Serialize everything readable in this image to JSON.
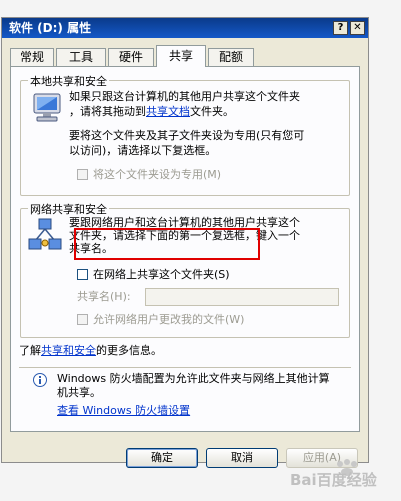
{
  "window": {
    "title": "软件 (D:) 属性",
    "help_glyph": "?",
    "close_glyph": "✕"
  },
  "tabs": [
    {
      "label": "常规"
    },
    {
      "label": "工具"
    },
    {
      "label": "硬件"
    },
    {
      "label": "共享"
    },
    {
      "label": "配额"
    }
  ],
  "local": {
    "legend": "本地共享和安全",
    "line1": "如果只跟这台计算机的其他用户共享这个文件夹",
    "line2_pre": "，请将其拖动到",
    "line2_link": "共享文档",
    "line2_post": "文件夹。",
    "line3": "要将这个文件夹及其子文件夹设为专用(只有您可",
    "line4": "以访问)，请选择以下复选框。",
    "checkbox_label": "将这个文件夹设为专用(M)"
  },
  "network": {
    "legend": "网络共享和安全",
    "line1": "要跟网络用户和这台计算机的其他用户共享这个",
    "line2": "文件夹，请选择下面的第一个复选框，键入一个",
    "line3": "共享名。",
    "share_checkbox_label": "在网络上共享这个文件夹(S)",
    "share_name_label": "共享名(H):",
    "share_name_value": "",
    "allow_change_label": "允许网络用户更改我的文件(W)"
  },
  "learn_more": {
    "pre": "了解",
    "link": "共享和安全",
    "post": "的更多信息。"
  },
  "firewall": {
    "line1": "Windows 防火墙配置为允许此文件夹与网络上其他计算",
    "line2": "机共享。",
    "link": "查看 Windows 防火墙设置"
  },
  "buttons": {
    "ok": "确定",
    "cancel": "取消",
    "apply": "应用(A)"
  },
  "watermark": {
    "text": "Bai百度经验"
  },
  "colors": {
    "highlight": "#e00000",
    "link": "#0033cc"
  }
}
